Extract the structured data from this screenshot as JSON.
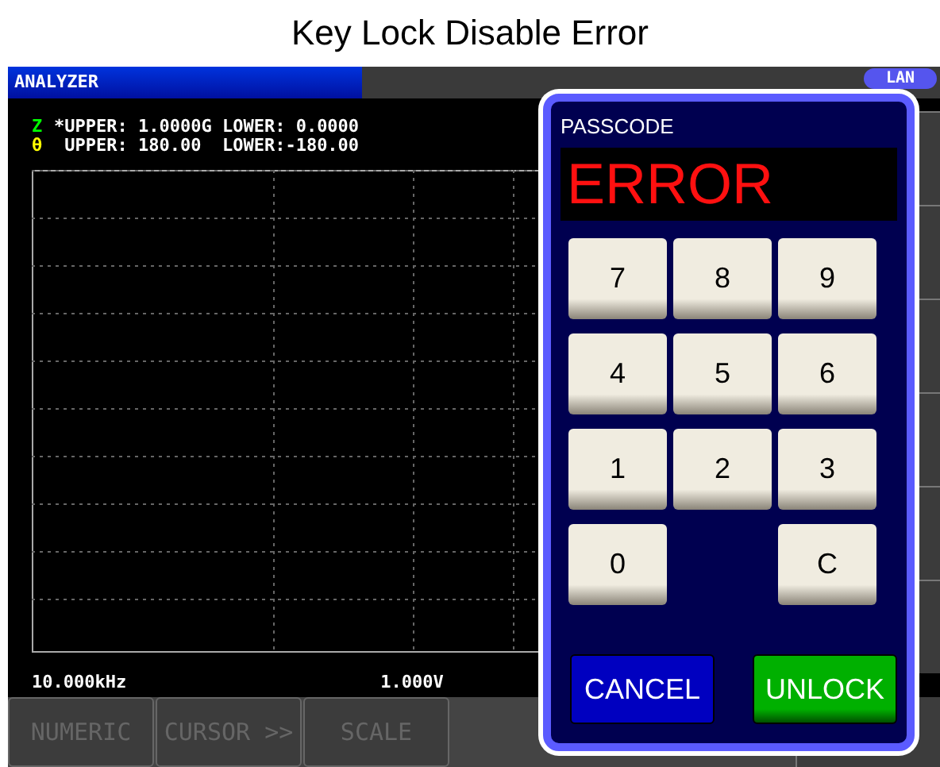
{
  "window": {
    "title": "Key Lock Disable Error"
  },
  "screen": {
    "mode": "ANALYZER",
    "badge": "LAN",
    "traces": [
      {
        "symbol": "Z",
        "color": "#00ff00",
        "text": "*UPPER: 1.0000G LOWER: 0.0000"
      },
      {
        "symbol": "θ",
        "color": "#ffff00",
        "text": " UPPER: 180.00  LOWER:-180.00"
      }
    ],
    "frequency": "10.000kHz",
    "voltage": "1.000V",
    "bottom_buttons": [
      "NUMERIC",
      "CURSOR >>",
      "SCALE"
    ]
  },
  "dialog": {
    "title": "PASSCODE",
    "display": "ERROR",
    "keys": [
      "7",
      "8",
      "9",
      "4",
      "5",
      "6",
      "1",
      "2",
      "3",
      "0",
      "C"
    ],
    "actions": [
      {
        "kind": "cancel",
        "label": "CANCEL"
      },
      {
        "kind": "unlock",
        "label": "UNLOCK"
      }
    ]
  }
}
